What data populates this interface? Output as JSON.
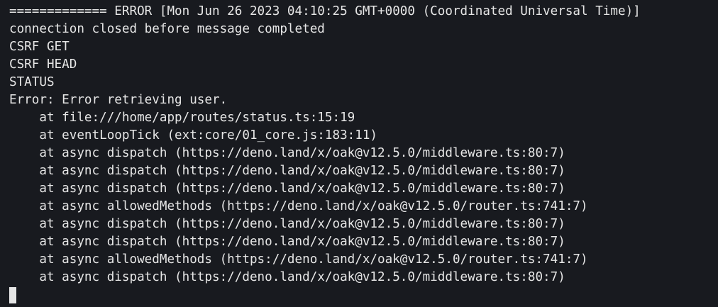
{
  "terminal": {
    "lines": [
      "============= ERROR [Mon Jun 26 2023 04:10:25 GMT+0000 (Coordinated Universal Time)]",
      "connection closed before message completed",
      "CSRF GET",
      "CSRF HEAD",
      "STATUS",
      "Error: Error retrieving user.",
      "    at file:///home/app/routes/status.ts:15:19",
      "    at eventLoopTick (ext:core/01_core.js:183:11)",
      "    at async dispatch (https://deno.land/x/oak@v12.5.0/middleware.ts:80:7)",
      "    at async dispatch (https://deno.land/x/oak@v12.5.0/middleware.ts:80:7)",
      "    at async dispatch (https://deno.land/x/oak@v12.5.0/middleware.ts:80:7)",
      "    at async allowedMethods (https://deno.land/x/oak@v12.5.0/router.ts:741:7)",
      "    at async dispatch (https://deno.land/x/oak@v12.5.0/middleware.ts:80:7)",
      "    at async dispatch (https://deno.land/x/oak@v12.5.0/middleware.ts:80:7)",
      "    at async allowedMethods (https://deno.land/x/oak@v12.5.0/router.ts:741:7)",
      "    at async dispatch (https://deno.land/x/oak@v12.5.0/middleware.ts:80:7)"
    ]
  },
  "colors": {
    "background": "#181a1f",
    "text": "#e6e6e6",
    "cursor": "#e6e6e6"
  }
}
